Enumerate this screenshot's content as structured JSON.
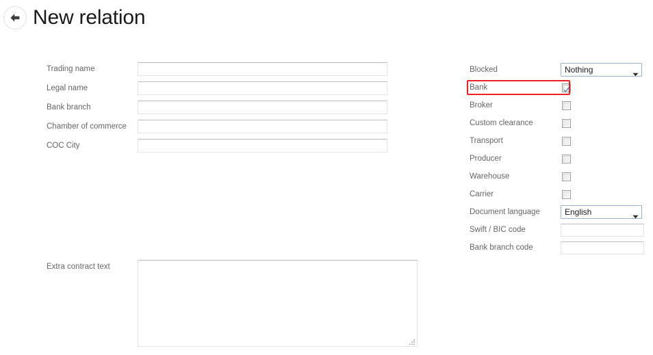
{
  "header": {
    "title": "New relation",
    "back_icon": "arrow-left-icon"
  },
  "left_column": {
    "fields": [
      {
        "label": "Trading name",
        "value": "",
        "placeholder": ""
      },
      {
        "label": "Legal name",
        "value": "",
        "placeholder": ""
      },
      {
        "label": "Bank branch",
        "value": "",
        "placeholder": ""
      },
      {
        "label": "Chamber of commerce",
        "value": "",
        "placeholder": ""
      },
      {
        "label": "COC City",
        "value": "",
        "placeholder": ""
      }
    ]
  },
  "right_column": {
    "blocked": {
      "label": "Blocked",
      "selected": "Nothing",
      "options": [
        "Nothing"
      ]
    },
    "checkboxes": [
      {
        "label": "Bank",
        "checked": true,
        "highlighted": true
      },
      {
        "label": "Broker",
        "checked": false,
        "highlighted": false
      },
      {
        "label": "Custom clearance",
        "checked": false,
        "highlighted": false
      },
      {
        "label": "Transport",
        "checked": false,
        "highlighted": false
      },
      {
        "label": "Producer",
        "checked": false,
        "highlighted": false
      },
      {
        "label": "Warehouse",
        "checked": false,
        "highlighted": false
      },
      {
        "label": "Carrier",
        "checked": false,
        "highlighted": false
      }
    ],
    "document_language": {
      "label": "Document language",
      "selected": "English",
      "options": [
        "English"
      ]
    },
    "fields": [
      {
        "label": "Swift / BIC code",
        "value": "",
        "placeholder": ""
      },
      {
        "label": "Bank branch code",
        "value": "",
        "placeholder": ""
      }
    ]
  },
  "contract": {
    "label": "Extra contract text",
    "value": "",
    "placeholder": ""
  },
  "colors": {
    "highlight": "#ee2222",
    "checkmark": "#2b5fb5",
    "combobox_border": "#9ab3d5",
    "label_text": "#666666",
    "title_text": "#1a1a1a",
    "background": "#ffffff"
  }
}
